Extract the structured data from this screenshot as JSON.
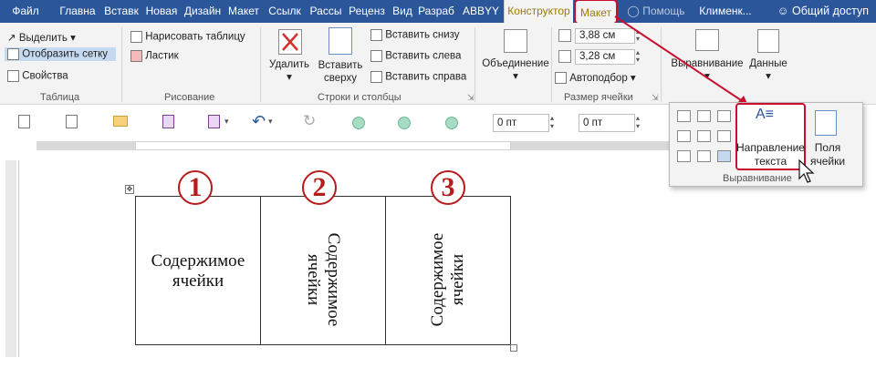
{
  "tabs": [
    "Файл",
    "Главна",
    "Вставк",
    "Новая",
    "Дизайн",
    "Макет",
    "Ссылк",
    "Рассы",
    "Реценз",
    "Вид",
    "Разраб",
    "ABBYY",
    "Конструктор",
    "Макет",
    "Помощь",
    "Клименк..."
  ],
  "share_label": "Общий доступ",
  "ribbon": {
    "table_group": {
      "select": "Выделить",
      "grid": "Отобразить сетку",
      "props": "Свойства",
      "label": "Таблица"
    },
    "draw_group": {
      "draw": "Нарисовать таблицу",
      "eraser": "Ластик",
      "label": "Рисование"
    },
    "rows_group": {
      "delete": "Удалить",
      "insert_above_1": "Вставить",
      "insert_above_2": "сверху",
      "insert_below": "Вставить снизу",
      "insert_left": "Вставить слева",
      "insert_right": "Вставить справа",
      "label": "Строки и столбцы"
    },
    "merge_group": {
      "merge": "Объединение"
    },
    "size_group": {
      "height": "3,88 см",
      "width": "3,28 см",
      "autofit": "Автоподбор",
      "label": "Размер ячейки"
    },
    "align_group": {
      "align": "Выравнивание",
      "data": "Данные"
    }
  },
  "qat": {
    "spacing_1": "0 пт",
    "spacing_2": "0 пт"
  },
  "popup": {
    "text_direction_1": "Направление",
    "text_direction_2": "текста",
    "margins_1": "Поля",
    "margins_2": "ячейки",
    "label": "Выравнивание"
  },
  "document": {
    "cell1_line1": "Содержимое",
    "cell1_line2": "ячейки",
    "cell2_line1": "Содержимое",
    "cell2_line2": "ячейки",
    "cell3_line1": "Содержимое",
    "cell3_line2": "ячейки",
    "markers": [
      "1",
      "2",
      "3"
    ]
  },
  "colors": {
    "accent": "#2b579a",
    "highlight": "#c8102e",
    "context_tab": "#ffe873"
  }
}
